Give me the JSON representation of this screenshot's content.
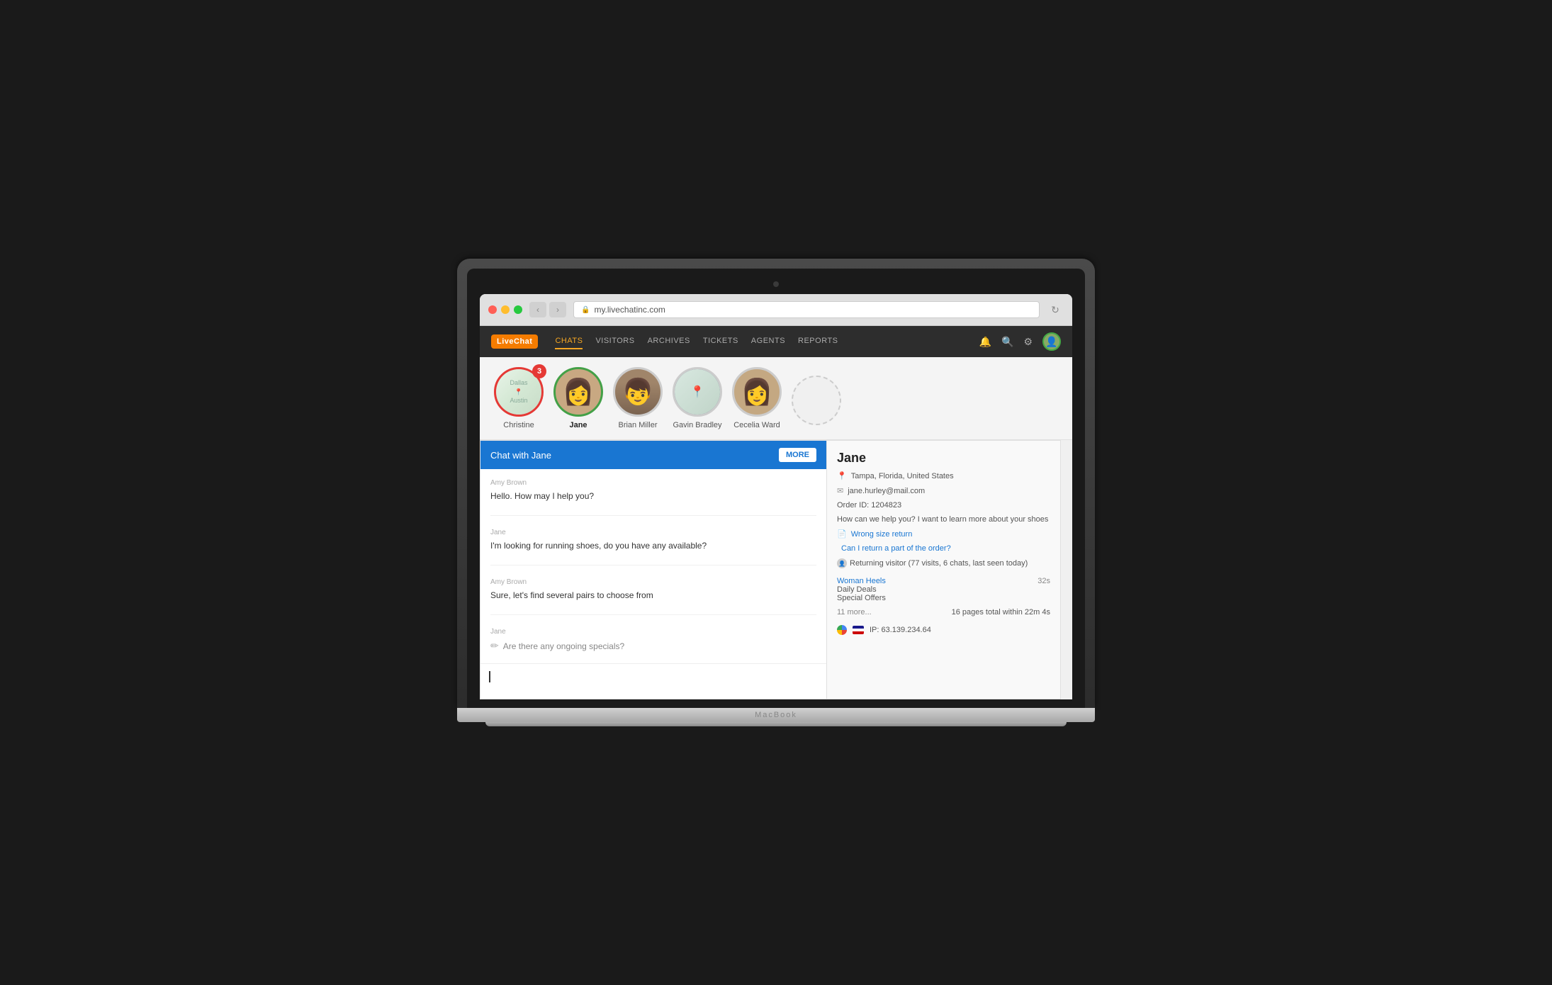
{
  "browser": {
    "url": "my.livechatinc.com",
    "back_label": "‹",
    "forward_label": "›",
    "refresh_label": "↻"
  },
  "nav": {
    "logo": "LiveChat",
    "items": [
      {
        "label": "CHATS",
        "active": true
      },
      {
        "label": "VISITORS",
        "active": false
      },
      {
        "label": "ARCHIVES",
        "active": false
      },
      {
        "label": "TICKETS",
        "active": false
      },
      {
        "label": "AGENTS",
        "active": false
      },
      {
        "label": "REPORTS",
        "active": false
      }
    ]
  },
  "chat_users": [
    {
      "name": "Christine",
      "bold": false,
      "type": "map"
    },
    {
      "name": "Jane",
      "bold": true,
      "type": "person"
    },
    {
      "name": "Brian Miller",
      "bold": false,
      "type": "person"
    },
    {
      "name": "Gavin Bradley",
      "bold": false,
      "type": "person"
    },
    {
      "name": "Cecelia Ward",
      "bold": false,
      "type": "person"
    },
    {
      "name": "",
      "bold": false,
      "type": "empty"
    }
  ],
  "christine_badge": "3",
  "chat_header": {
    "title": "Chat with Jane",
    "more_button": "MORE"
  },
  "messages": [
    {
      "sender": "Amy Brown",
      "text": "Hello. How may I help you?",
      "typing": false
    },
    {
      "sender": "Jane",
      "text": "I'm looking for running shoes, do you have any available?",
      "typing": false
    },
    {
      "sender": "Amy Brown",
      "text": "Sure, let's find several pairs to choose from",
      "typing": false
    },
    {
      "sender": "Jane",
      "text": "Are there any ongoing specials?",
      "typing": true
    }
  ],
  "sidebar": {
    "name": "Jane",
    "location": "Tampa, Florida, United States",
    "email": "jane.hurley@mail.com",
    "order_id_label": "Order ID: 1204823",
    "question": "How can we help you? I want to learn more about your shoes",
    "links": [
      {
        "text": "Wrong size return"
      },
      {
        "text": "Can I return a part of the order?"
      }
    ],
    "visitor_info": "Returning visitor  (77 visits, 6 chats, last seen today)",
    "pages": [
      {
        "name": "Woman Heels",
        "time": "32s"
      },
      {
        "name": "Daily Deals",
        "time": ""
      },
      {
        "name": "Special Offers",
        "time": ""
      }
    ],
    "more_pages": "11 more...",
    "total_pages": "16 pages total within 22m 4s",
    "ip": "IP: 63.139.234.64"
  },
  "macbook_label": "MacBook"
}
